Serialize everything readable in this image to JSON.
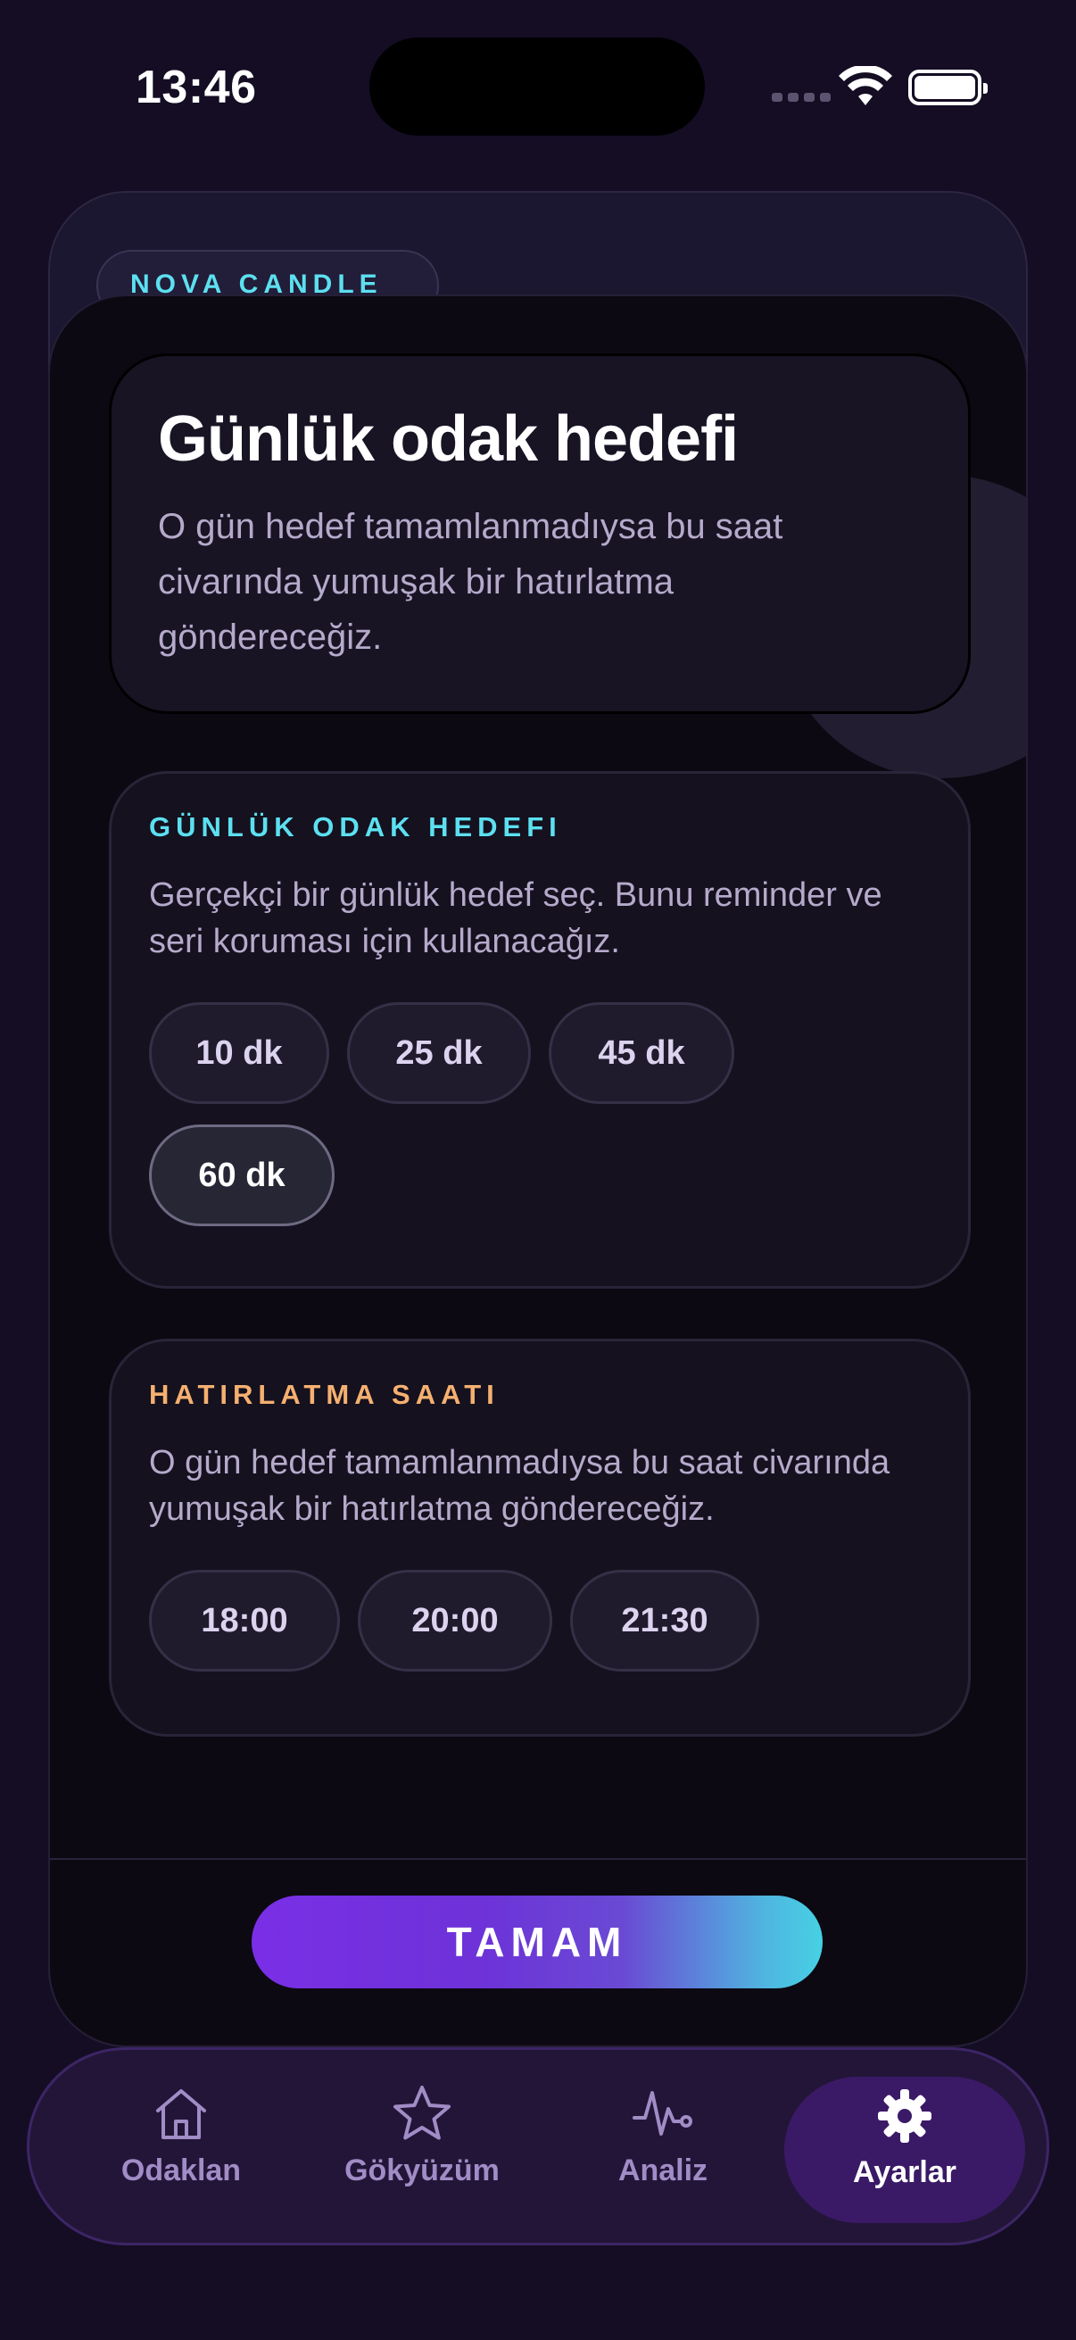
{
  "status_bar": {
    "time": "13:46"
  },
  "brand": {
    "name": "NOVA CANDLE"
  },
  "hero": {
    "title": "Günlük odak hedefi",
    "subtitle": "O gün hedef tamamlanmadıysa bu saat civarında yumuşak bir hatırlatma göndereceğiz."
  },
  "goal_card": {
    "eyebrow": "GÜNLÜK ODAK HEDEFI",
    "description": "Gerçekçi bir günlük hedef seç. Bunu reminder ve seri koruması için kullanacağız.",
    "options": [
      "10 dk",
      "25 dk",
      "45 dk",
      "60 dk"
    ],
    "selected": "60 dk",
    "accent": "#5ce0f0"
  },
  "reminder_card": {
    "eyebrow": "HATIRLATMA SAATI",
    "description": "O gün hedef tamamlanmadıysa bu saat civarında yumuşak bir hatırlatma göndereceğiz.",
    "options": [
      "18:00",
      "20:00",
      "21:30"
    ],
    "accent": "#f5b070"
  },
  "confirm_button": {
    "label": "TAMAM"
  },
  "tabbar": {
    "items": [
      {
        "label": "Odaklan",
        "icon": "home-icon"
      },
      {
        "label": "Gökyüzüm",
        "icon": "star-icon"
      },
      {
        "label": "Analiz",
        "icon": "pulse-icon"
      },
      {
        "label": "Ayarlar",
        "icon": "gear-icon",
        "active": true
      }
    ]
  }
}
